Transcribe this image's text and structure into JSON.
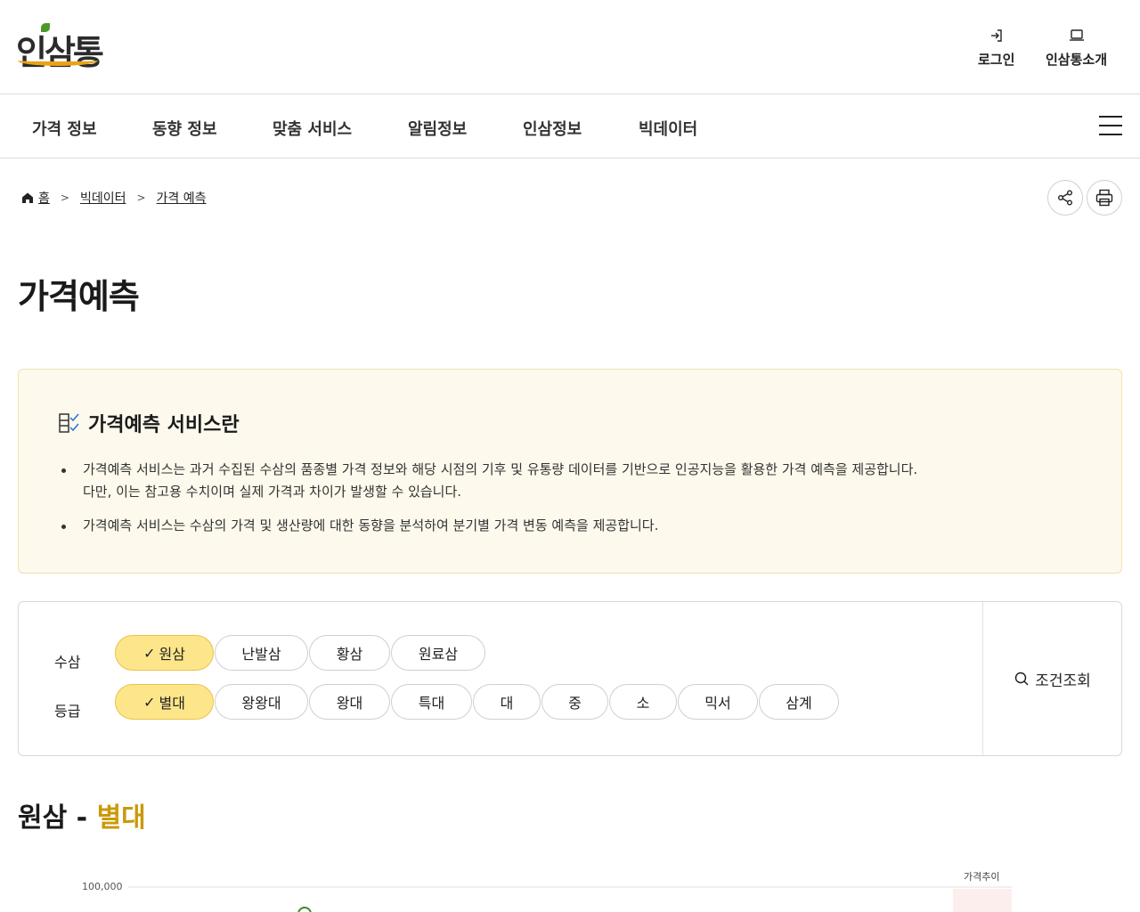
{
  "header": {
    "logo_text": "인삼통",
    "login_label": "로그인",
    "about_label": "인삼통소개"
  },
  "gnb": {
    "items": [
      "가격 정보",
      "동향 정보",
      "맞춤 서비스",
      "알림정보",
      "인삼정보",
      "빅데이터"
    ]
  },
  "breadcrumb": {
    "home": "홈",
    "level1": "빅데이터",
    "level2": "가격 예측"
  },
  "page": {
    "title": "가격예측"
  },
  "info": {
    "title": "가격예측 서비스란",
    "item1_line1": "가격예측 서비스는 과거 수집된 수삼의 품종별 가격 정보와 해당 시점의 기후 및 유통량 데이터를 기반으로 인공지능을 활용한 가격 예측을 제공합니다.",
    "item1_line2": "다만, 이는 참고용 수치이며 실제 가격과 차이가 발생할 수 있습니다.",
    "item2": "가격예측 서비스는 수삼의 가격 및 생산량에 대한 동향을 분석하여 분기별 가격 변동 예측을 제공합니다."
  },
  "filter": {
    "type_label": "수삼",
    "grade_label": "등급",
    "types": [
      "원삼",
      "난발삼",
      "황삼",
      "원료삼"
    ],
    "grades": [
      "별대",
      "왕왕대",
      "왕대",
      "특대",
      "대",
      "중",
      "소",
      "믹서",
      "삼계"
    ],
    "check_mark": "✓",
    "search_label": "조건조회"
  },
  "result": {
    "type": "원삼",
    "dash": "-",
    "grade": "별대"
  },
  "chart_data": {
    "type": "line",
    "ytick_top": "100,000",
    "legend": "가격추이"
  }
}
